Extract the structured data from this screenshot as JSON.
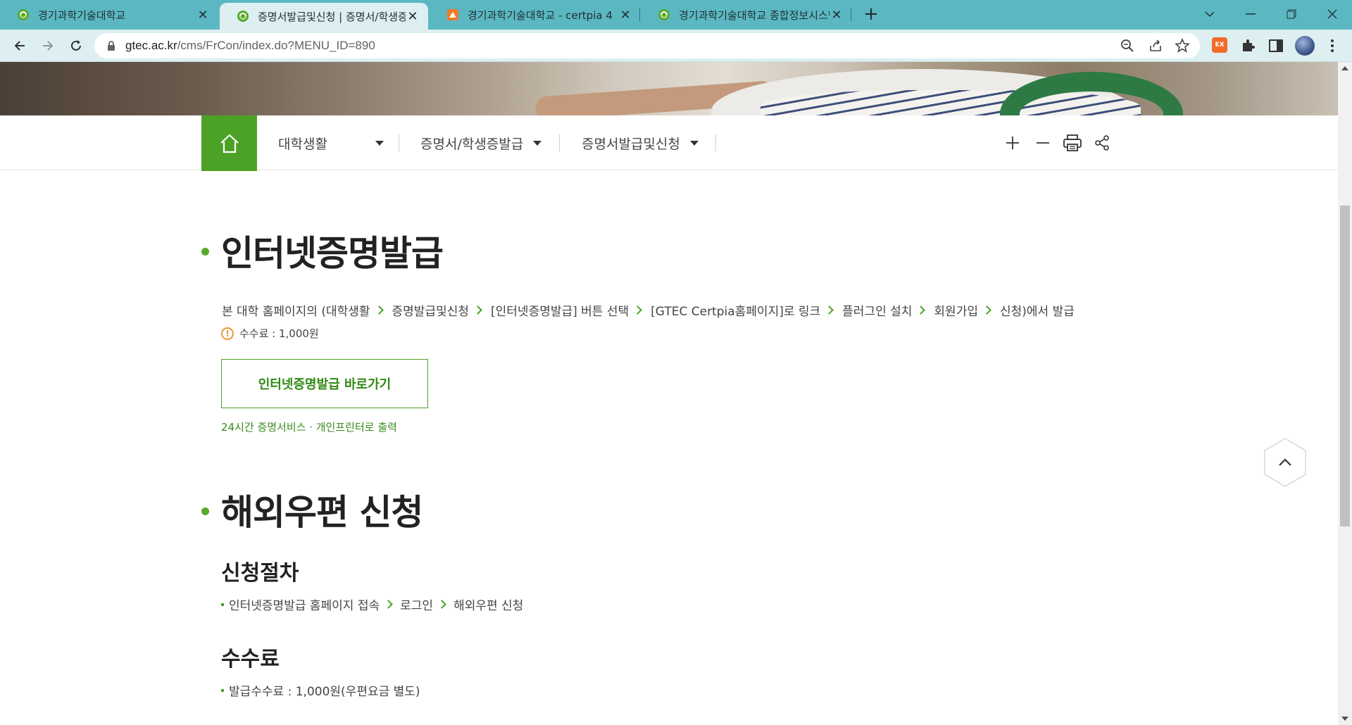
{
  "browser": {
    "tabs": [
      {
        "title": "경기과학기술대학교",
        "active": false
      },
      {
        "title": "증명서발급및신청 | 증명서/학생증발급",
        "active": true
      },
      {
        "title": "경기과학기술대학교 - certpia 4",
        "active": false
      },
      {
        "title": "경기과학기술대학교 종합정보시스템",
        "active": false
      }
    ],
    "new_tab_label": "+",
    "url_host": "gtec.ac.kr",
    "url_path": "/cms/FrCon/index.do?MENU_ID=890",
    "extension_badge": "EX",
    "accent_color": "#5bb8c3"
  },
  "subnav": {
    "menus": [
      {
        "label": "대학생활"
      },
      {
        "label": "증명서/학생증발급"
      },
      {
        "label": "증명서발급및신청"
      }
    ],
    "brand_color": "#4ca226"
  },
  "section1": {
    "title": "인터넷증명발급",
    "steps": [
      "본 대학 홈페이지의 (대학생활",
      "증명발급및신청",
      "[인터넷증명발급] 버튼 선택",
      "[GTEC Certpia홈페이지]로 링크",
      "플러그인 설치",
      "회원가입",
      "신청)에서 발급"
    ],
    "fee_note": "수수료 : 1,000원",
    "button_label": "인터넷증명발급 바로가기",
    "service_note": "24시간 증명서비스 · 개인프린터로 출력"
  },
  "section2": {
    "title": "해외우편 신청",
    "procedure_title": "신청절차",
    "procedure_steps": [
      "인터넷증명발급 홈페이지 접속",
      "로그인",
      "해외우편 신청"
    ],
    "fee_title": "수수료",
    "fee_text": "발급수수료 : 1,000원(우편요금 별도)"
  }
}
